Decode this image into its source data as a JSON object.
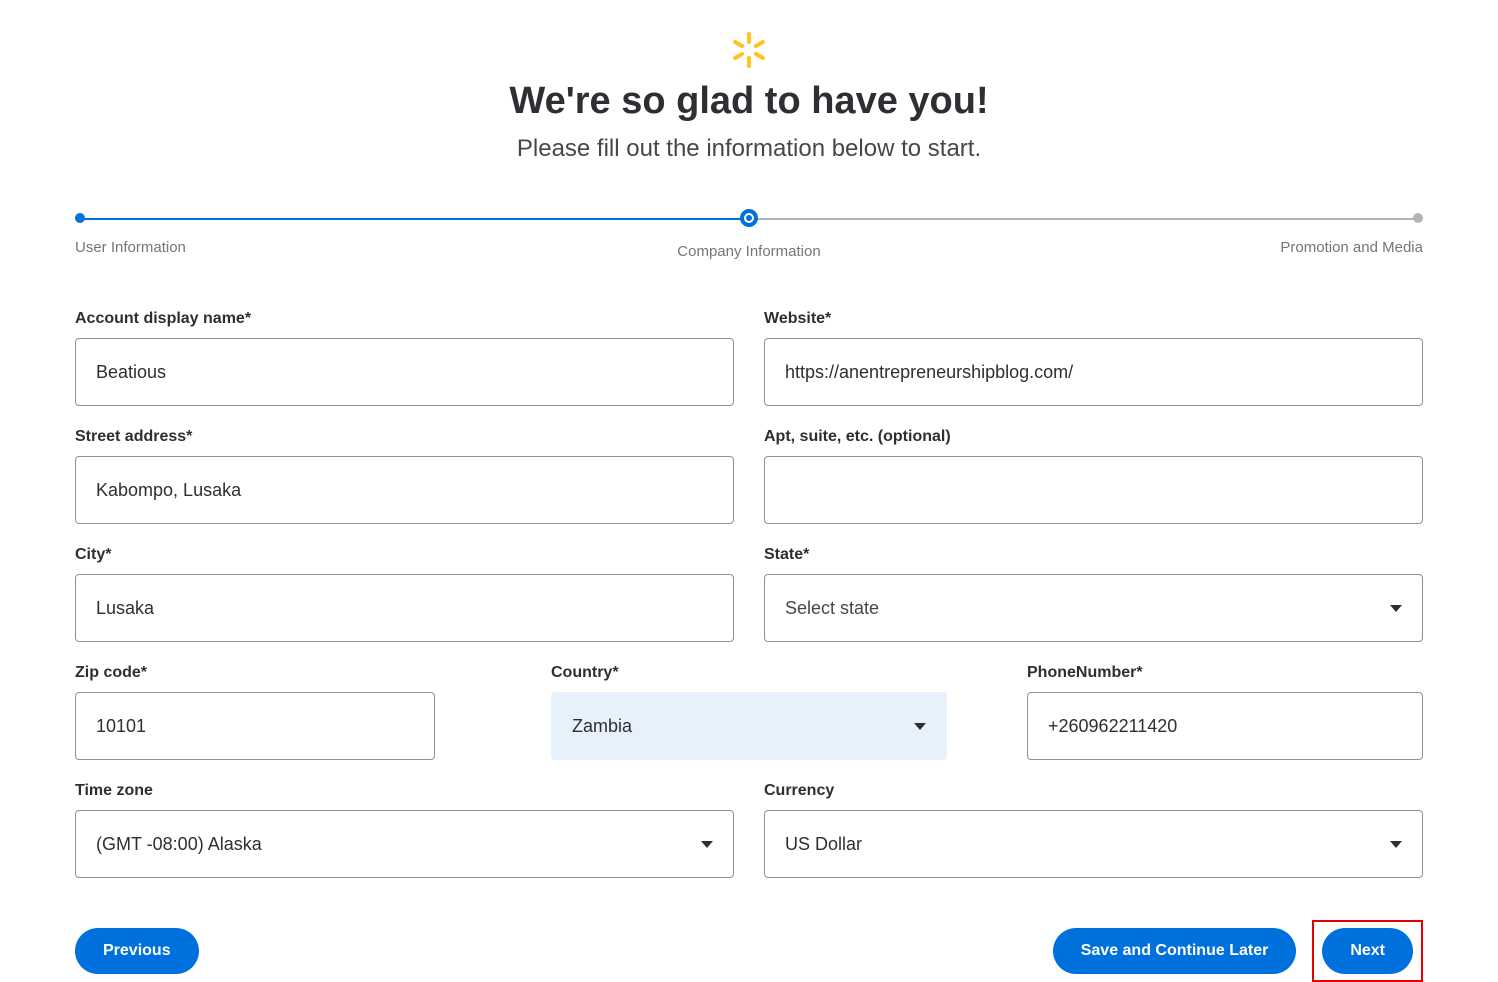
{
  "header": {
    "title": "We're so glad to have you!",
    "subtitle": "Please fill out the information below to start."
  },
  "stepper": {
    "step1": "User Information",
    "step2": "Company Information",
    "step3": "Promotion and Media"
  },
  "form": {
    "accountDisplayName": {
      "label": "Account display name*",
      "value": "Beatious"
    },
    "website": {
      "label": "Website*",
      "value": "https://anentrepreneurshipblog.com/"
    },
    "streetAddress": {
      "label": "Street address*",
      "value": "Kabompo, Lusaka"
    },
    "apt": {
      "label": "Apt, suite, etc. (optional)",
      "value": ""
    },
    "city": {
      "label": "City*",
      "value": "Lusaka"
    },
    "state": {
      "label": "State*",
      "value": "Select state"
    },
    "zip": {
      "label": "Zip code*",
      "value": "10101"
    },
    "country": {
      "label": "Country*",
      "value": "Zambia"
    },
    "phone": {
      "label": "PhoneNumber*",
      "value": "+260962211420"
    },
    "timezone": {
      "label": "Time zone",
      "value": "(GMT -08:00) Alaska"
    },
    "currency": {
      "label": "Currency",
      "value": "US Dollar"
    }
  },
  "buttons": {
    "previous": "Previous",
    "saveLater": "Save and Continue Later",
    "next": "Next"
  }
}
